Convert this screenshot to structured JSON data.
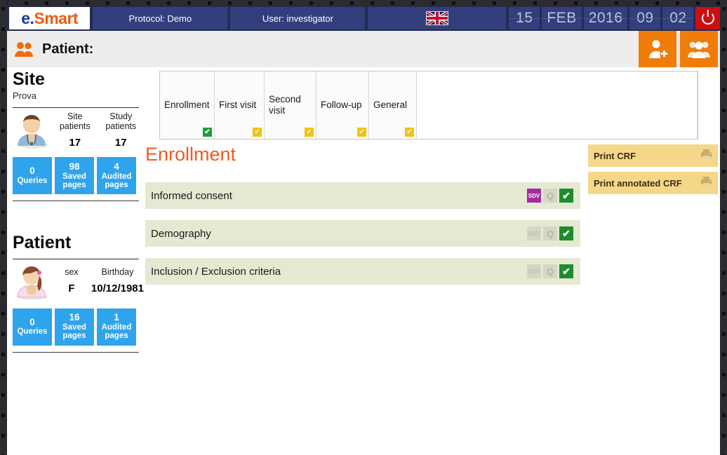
{
  "header": {
    "logo": {
      "part1": "e",
      "dot": ".",
      "part2": "Smart"
    },
    "protocol": "Protocol: Demo",
    "user": "User: investigator",
    "flag_icon": "uk-flag-icon",
    "datetime": {
      "day": "15",
      "month": "FEB",
      "year": "2016",
      "hour": "09",
      "minute": "02"
    },
    "power_label": "power-off"
  },
  "patient_bar": {
    "icon": "patients-icon",
    "title": "Patient:",
    "add_patient_label": "add-patient",
    "patient_list_label": "patient-list"
  },
  "sidebar": {
    "site": {
      "heading": "Site",
      "name": "Prova",
      "metrics": [
        {
          "label_line1": "Site",
          "label_line2": "patients",
          "value": "17"
        },
        {
          "label_line1": "Study",
          "label_line2": "patients",
          "value": "17"
        }
      ],
      "stats": [
        {
          "num": "0",
          "lbl": "Queries"
        },
        {
          "num": "98",
          "lbl_line1": "Saved",
          "lbl_line2": "pages"
        },
        {
          "num": "4",
          "lbl_line1": "Audited",
          "lbl_line2": "pages"
        }
      ]
    },
    "patient": {
      "heading": "Patient",
      "fields": [
        {
          "label": "sex",
          "value": "F"
        },
        {
          "label": "Birthday",
          "value": "10/12/1981"
        }
      ],
      "stats": [
        {
          "num": "0",
          "lbl": "Queries"
        },
        {
          "num": "16",
          "lbl_line1": "Saved",
          "lbl_line2": "pages"
        },
        {
          "num": "1",
          "lbl_line1": "Audited",
          "lbl_line2": "pages"
        }
      ]
    }
  },
  "tabs": [
    {
      "label": "Enrollment",
      "status": "green",
      "check": "✔"
    },
    {
      "label": "First visit",
      "status": "yellow",
      "check": "✓"
    },
    {
      "label": "Second visit",
      "status": "yellow",
      "check": "✓"
    },
    {
      "label": "Follow-up",
      "status": "yellow",
      "check": "✓"
    },
    {
      "label": "General",
      "status": "yellow",
      "check": "✓"
    }
  ],
  "main": {
    "section_title": "Enrollment",
    "rows": [
      {
        "name": "Informed consent",
        "sdv": "SDV",
        "sdv_active": true,
        "q": "Q",
        "check": "✔"
      },
      {
        "name": "Demography",
        "sdv": "SDV",
        "sdv_active": false,
        "q": "Q",
        "check": "✔"
      },
      {
        "name": "Inclusion / Exclusion criteria",
        "sdv": "SDV",
        "sdv_active": false,
        "q": "Q",
        "check": "✔"
      }
    ]
  },
  "print_panel": {
    "buttons": [
      {
        "label": "Print CRF",
        "icon": "printer-icon"
      },
      {
        "label": "Print annotated CRF",
        "icon": "printer-icon"
      }
    ]
  },
  "colors": {
    "header_blue": "#232c52",
    "panel_blue": "#333f7d",
    "accent_orange": "#f07c0a",
    "title_orange": "#f05a22",
    "row_green": "#e5e9d2",
    "stat_blue": "#2fa3ec",
    "print_tan": "#f5d78a",
    "power_red": "#cc0e10",
    "sdv_purple": "#a32ba0",
    "check_green": "#1e8c2e"
  }
}
